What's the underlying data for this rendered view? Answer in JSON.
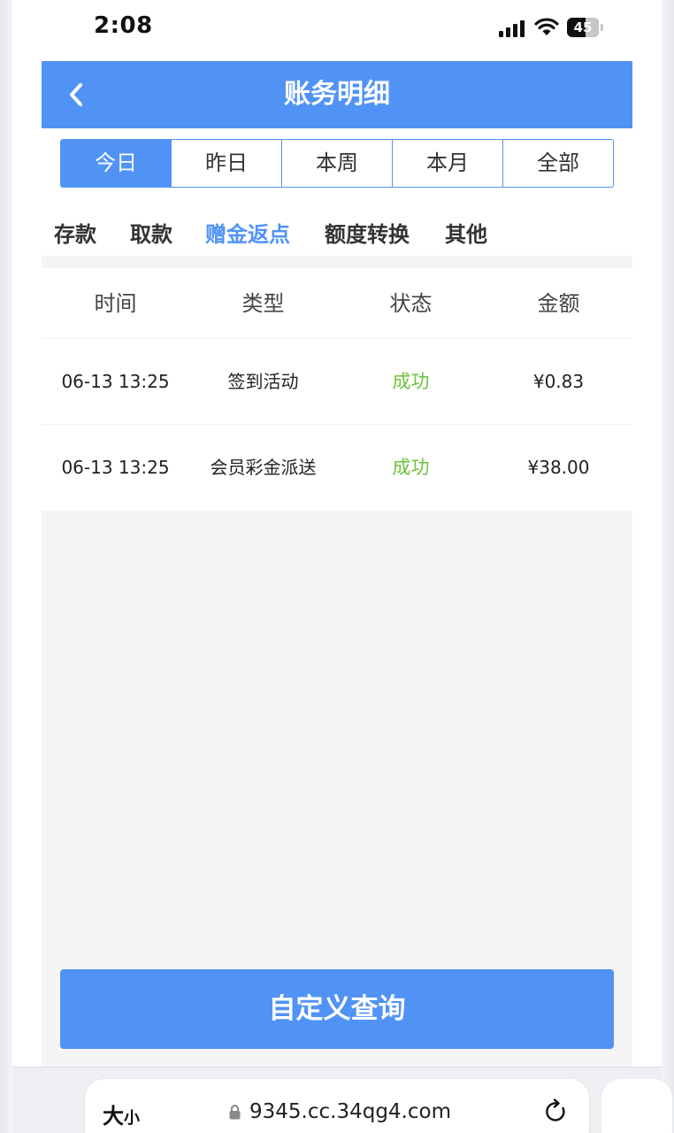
{
  "status_bar": {
    "time": "2:08",
    "battery": "45",
    "icons": [
      "signal-icon",
      "wifi-icon",
      "battery-icon"
    ]
  },
  "header": {
    "title": "账务明细",
    "back_icon": "chevron-left-icon"
  },
  "period_tabs": [
    {
      "label": "今日",
      "active": true
    },
    {
      "label": "昨日",
      "active": false
    },
    {
      "label": "本周",
      "active": false
    },
    {
      "label": "本月",
      "active": false
    },
    {
      "label": "全部",
      "active": false
    }
  ],
  "category_tabs": [
    {
      "label": "存款",
      "active": false
    },
    {
      "label": "取款",
      "active": false
    },
    {
      "label": "赠金返点",
      "active": true
    },
    {
      "label": "额度转换",
      "active": false
    },
    {
      "label": "其他",
      "active": false
    }
  ],
  "table": {
    "columns": [
      "时间",
      "类型",
      "状态",
      "金额"
    ],
    "rows": [
      {
        "time": "06-13 13:25",
        "type": "签到活动",
        "status": "成功",
        "amount": "¥0.83"
      },
      {
        "time": "06-13 13:25",
        "type": "会员彩金派送",
        "status": "成功",
        "amount": "¥38.00"
      }
    ]
  },
  "query_button": {
    "label": "自定义查询"
  },
  "browser_bar": {
    "text_size_big": "大",
    "text_size_small": "小",
    "url": "9345.cc.34qg4.com",
    "icons": [
      "lock-icon",
      "reload-icon"
    ]
  },
  "colors": {
    "accent": "#5193f5",
    "success": "#6ec23f",
    "background": "#f5f5f5"
  }
}
